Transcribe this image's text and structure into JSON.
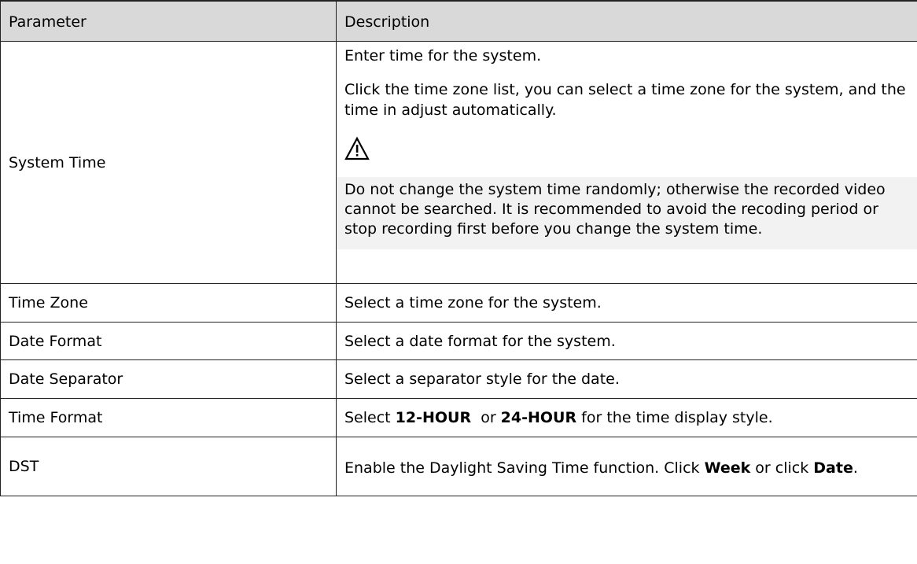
{
  "table": {
    "header": {
      "parameter": "Parameter",
      "description": "Description"
    },
    "system_time": {
      "parameter": "System Time",
      "para1": "Enter time for the system.",
      "para2": "Click the time zone list, you can select a time zone for the system, and the time in adjust automatically.",
      "note_icon": "warning-triangle-icon",
      "note": "Do not change the system time randomly; otherwise the recorded video cannot be searched. It is recommended to avoid the recoding period or stop recording first before you change the system time."
    },
    "time_zone": {
      "parameter": "Time Zone",
      "description": "Select a time zone for the system."
    },
    "date_format": {
      "parameter": "Date Format",
      "description": "Select a date format for the system."
    },
    "date_separator": {
      "parameter": "Date Separator",
      "description": "Select a separator style for the date."
    },
    "time_format": {
      "parameter": "Time Format",
      "desc_pre": "Select ",
      "opt1": "12-HOUR",
      "desc_mid": "  or ",
      "opt2": "24-HOUR",
      "desc_post": " for the time display style."
    },
    "dst": {
      "parameter": "DST",
      "desc_pre": "Enable the Daylight Saving Time function. Click ",
      "opt1": "Week",
      "desc_mid": " or click ",
      "opt2": "Date",
      "desc_post": "."
    }
  }
}
